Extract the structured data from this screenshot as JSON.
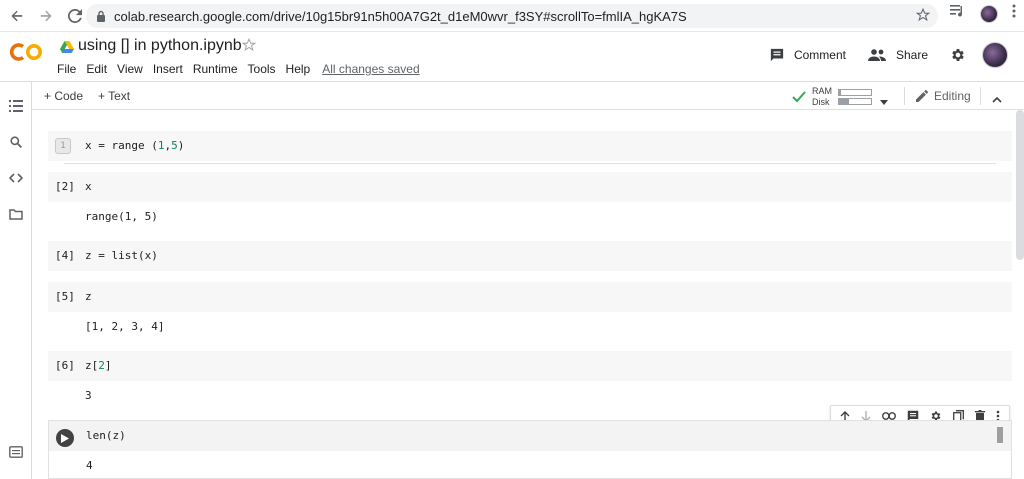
{
  "browser": {
    "url": "colab.research.google.com/drive/10g15br91n5h00A7G2t_d1eM0wvr_f3SY#scrollTo=fmlIA_hgKA7S"
  },
  "header": {
    "logo_text": "CO",
    "notebook_title": "using [] in python.ipynb",
    "menu": [
      "File",
      "Edit",
      "View",
      "Insert",
      "Runtime",
      "Tools",
      "Help"
    ],
    "save_status": "All changes saved",
    "comment_label": "Comment",
    "share_label": "Share"
  },
  "toolbar": {
    "add_code": "+ Code",
    "add_text": "+ Text",
    "ram_label": "RAM",
    "disk_label": "Disk",
    "ram_usage": 0.05,
    "disk_usage": 0.3,
    "editing_label": "Editing"
  },
  "cells": [
    {
      "exec": "1",
      "code": "x = range (1,5)",
      "output": ""
    },
    {
      "exec": "[2]",
      "code": "x",
      "output": "range(1, 5)"
    },
    {
      "exec": "[4]",
      "code": "z = list(x)",
      "output": ""
    },
    {
      "exec": "[5]",
      "code": "z",
      "output": "[1, 2, 3, 4]"
    },
    {
      "exec": "[6]",
      "code": "z[2]",
      "output": "3"
    },
    {
      "exec": "",
      "code": "len(z)",
      "output": "4"
    }
  ],
  "colors": {
    "logo_orange": "#e8710a",
    "logo_yellow": "#f9ab00",
    "connected_green": "#34a853",
    "number_green": "#098658"
  }
}
